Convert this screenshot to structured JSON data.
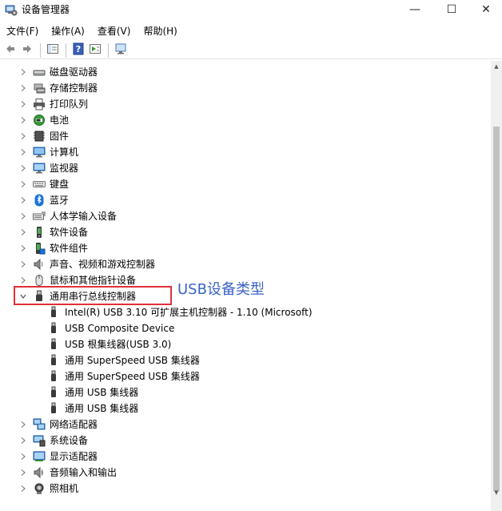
{
  "window": {
    "title": "设备管理器",
    "min_label": "—",
    "max_label": "☐",
    "close_label": "✕"
  },
  "menu": {
    "items": [
      "文件(F)",
      "操作(A)",
      "查看(V)",
      "帮助(H)"
    ]
  },
  "tree": {
    "categories": [
      {
        "label": "磁盘驱动器",
        "icon": "disk-drive-icon",
        "expanded": false
      },
      {
        "label": "存储控制器",
        "icon": "storage-controller-icon",
        "expanded": false
      },
      {
        "label": "打印队列",
        "icon": "printer-icon",
        "expanded": false
      },
      {
        "label": "电池",
        "icon": "battery-icon",
        "expanded": false
      },
      {
        "label": "固件",
        "icon": "firmware-icon",
        "expanded": false
      },
      {
        "label": "计算机",
        "icon": "computer-icon",
        "expanded": false
      },
      {
        "label": "监视器",
        "icon": "monitor-icon",
        "expanded": false
      },
      {
        "label": "键盘",
        "icon": "keyboard-icon",
        "expanded": false
      },
      {
        "label": "蓝牙",
        "icon": "bluetooth-icon",
        "expanded": false
      },
      {
        "label": "人体学输入设备",
        "icon": "hid-icon",
        "expanded": false
      },
      {
        "label": "软件设备",
        "icon": "software-device-icon",
        "expanded": false
      },
      {
        "label": "软件组件",
        "icon": "software-component-icon",
        "expanded": false
      },
      {
        "label": "声音、视频和游戏控制器",
        "icon": "speaker-icon",
        "expanded": false
      },
      {
        "label": "鼠标和其他指针设备",
        "icon": "mouse-icon",
        "expanded": false
      },
      {
        "label": "通用串行总线控制器",
        "icon": "usb-icon",
        "expanded": true
      },
      {
        "label": "网络适配器",
        "icon": "network-adapter-icon",
        "expanded": false
      },
      {
        "label": "系统设备",
        "icon": "system-device-icon",
        "expanded": false
      },
      {
        "label": "显示适配器",
        "icon": "display-adapter-icon",
        "expanded": false
      },
      {
        "label": "音频输入和输出",
        "icon": "audio-io-icon",
        "expanded": false
      },
      {
        "label": "照相机",
        "icon": "camera-icon",
        "expanded": false
      }
    ],
    "usb_children": [
      "Intel(R) USB 3.10 可扩展主机控制器 - 1.10 (Microsoft)",
      "USB Composite Device",
      "USB 根集线器(USB 3.0)",
      "通用 SuperSpeed USB 集线器",
      "通用 SuperSpeed USB 集线器",
      "通用 USB 集线器",
      "通用 USB 集线器"
    ]
  },
  "annotation": {
    "text": "USB设备类型",
    "box_color": "#e0303a",
    "text_color": "#3a63c8"
  },
  "colors": {
    "accent": "#3a63c8",
    "highlight": "#e0303a"
  }
}
